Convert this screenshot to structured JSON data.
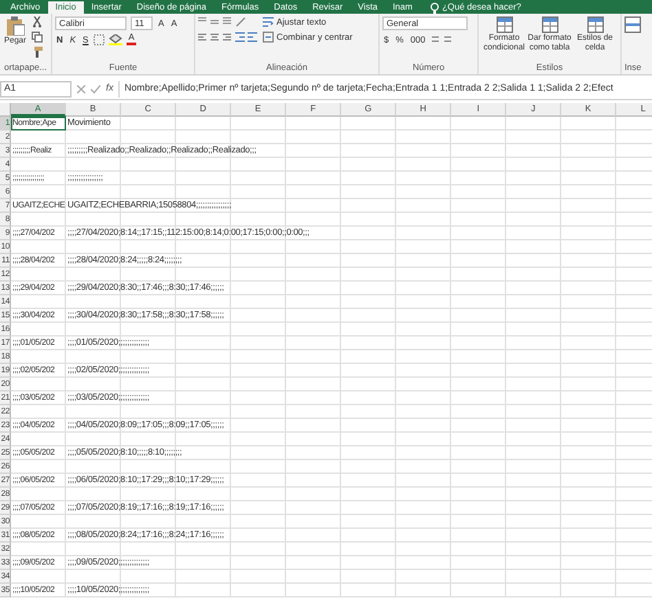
{
  "tabs": [
    {
      "label": "Archivo",
      "selected": false
    },
    {
      "label": "Inicio",
      "selected": true
    },
    {
      "label": "Insertar",
      "selected": false
    },
    {
      "label": "Diseño de página",
      "selected": false
    },
    {
      "label": "Fórmulas",
      "selected": false
    },
    {
      "label": "Datos",
      "selected": false
    },
    {
      "label": "Revisar",
      "selected": false
    },
    {
      "label": "Vista",
      "selected": false
    },
    {
      "label": "Inam",
      "selected": false
    }
  ],
  "tell_me": "¿Qué desea hacer?",
  "ribbon": {
    "clipboard": {
      "paste": "Pegar",
      "label": "ortapape..."
    },
    "font": {
      "name": "Calibri",
      "size": "11",
      "grow": "A",
      "shrink": "A",
      "bold": "N",
      "italic": "K",
      "underline": "S",
      "font_color_button": "A",
      "label": "Fuente"
    },
    "alignment": {
      "wrap": "Ajustar texto",
      "merge": "Combinar y centrar",
      "label": "Alineación"
    },
    "number": {
      "format": "General",
      "currency": "$",
      "percent": "%",
      "thousands": "000",
      "label": "Número"
    },
    "styles": {
      "conditional": "Formato condicional",
      "table": "Dar formato como tabla",
      "cell": "Estilos de celda",
      "label": "Estilos"
    },
    "insert": {
      "label": "Inse"
    }
  },
  "formula_bar": {
    "name_box": "A1",
    "function_label": "fx",
    "formula": "Nombre;Apellido;Primer nº tarjeta;Segundo nº de tarjeta;Fecha;Entrada 1 1;Entrada 2 2;Salida 1 1;Salida 2 2;Efect"
  },
  "columns": [
    {
      "label": "A",
      "selected": true
    },
    {
      "label": "B",
      "selected": false
    },
    {
      "label": "C",
      "selected": false
    },
    {
      "label": "D",
      "selected": false
    },
    {
      "label": "E",
      "selected": false
    },
    {
      "label": "F",
      "selected": false
    },
    {
      "label": "G",
      "selected": false
    },
    {
      "label": "H",
      "selected": false
    },
    {
      "label": "I",
      "selected": false
    },
    {
      "label": "J",
      "selected": false
    },
    {
      "label": "K",
      "selected": false
    },
    {
      "label": "L",
      "selected": false
    }
  ],
  "rows": [
    {
      "number": "1",
      "selected": true,
      "cells": [
        {
          "text": "Nombre;Ape",
          "selected": true
        },
        {
          "text": "Movimiento",
          "selected": false
        }
      ]
    },
    {
      "number": "2",
      "selected": false
    },
    {
      "number": "3",
      "selected": false,
      "cells": [
        {
          "text": ";;;;;;;;;Realiz",
          "selected": false
        },
        {
          "text": ";;;;;;;;;Realizado;;Realizado;;Realizado;;Realizado;;;",
          "selected": false
        }
      ]
    },
    {
      "number": "4",
      "selected": false
    },
    {
      "number": "5",
      "selected": false,
      "cells": [
        {
          "text": ";;;;;;;;;;;;;;;;",
          "selected": false
        },
        {
          "text": ";;;;;;;;;;;;;;;;",
          "selected": false
        }
      ]
    },
    {
      "number": "6",
      "selected": false
    },
    {
      "number": "7",
      "selected": false,
      "cells": [
        {
          "text": "UGAITZ;ECHE",
          "selected": false
        },
        {
          "text": "UGAITZ;ECHEBARRIA;15058804;;;;;;;;;;;;;;;;",
          "selected": false
        }
      ]
    },
    {
      "number": "8",
      "selected": false
    },
    {
      "number": "9",
      "selected": false,
      "cells": [
        {
          "text": ";;;;27/04/202",
          "selected": false
        },
        {
          "text": ";;;;27/04/2020;8:14;;17:15;;112:15:00;8:14;0:00;17:15;0:00;;0:00;;;",
          "selected": false
        }
      ]
    },
    {
      "number": "10",
      "selected": false
    },
    {
      "number": "11",
      "selected": false,
      "cells": [
        {
          "text": ";;;;28/04/202",
          "selected": false
        },
        {
          "text": ";;;;28/04/2020;8:24;;;;;8:24;;;;;;;;",
          "selected": false
        }
      ]
    },
    {
      "number": "12",
      "selected": false
    },
    {
      "number": "13",
      "selected": false,
      "cells": [
        {
          "text": ";;;;29/04/202",
          "selected": false
        },
        {
          "text": ";;;;29/04/2020;8:30;;17:46;;;8:30;;17:46;;;;;;",
          "selected": false
        }
      ]
    },
    {
      "number": "14",
      "selected": false
    },
    {
      "number": "15",
      "selected": false,
      "cells": [
        {
          "text": ";;;;30/04/202",
          "selected": false
        },
        {
          "text": ";;;;30/04/2020;8:30;;17:58;;;8:30;;17:58;;;;;;",
          "selected": false
        }
      ]
    },
    {
      "number": "16",
      "selected": false
    },
    {
      "number": "17",
      "selected": false,
      "cells": [
        {
          "text": ";;;;01/05/202",
          "selected": false
        },
        {
          "text": ";;;;01/05/2020;;;;;;;;;;;;;;",
          "selected": false
        }
      ]
    },
    {
      "number": "18",
      "selected": false
    },
    {
      "number": "19",
      "selected": false,
      "cells": [
        {
          "text": ";;;;02/05/202",
          "selected": false
        },
        {
          "text": ";;;;02/05/2020;;;;;;;;;;;;;;",
          "selected": false
        }
      ]
    },
    {
      "number": "20",
      "selected": false
    },
    {
      "number": "21",
      "selected": false,
      "cells": [
        {
          "text": ";;;;03/05/202",
          "selected": false
        },
        {
          "text": ";;;;03/05/2020;;;;;;;;;;;;;;",
          "selected": false
        }
      ]
    },
    {
      "number": "22",
      "selected": false
    },
    {
      "number": "23",
      "selected": false,
      "cells": [
        {
          "text": ";;;;04/05/202",
          "selected": false
        },
        {
          "text": ";;;;04/05/2020;8:09;;17:05;;;8:09;;17:05;;;;;;",
          "selected": false
        }
      ]
    },
    {
      "number": "24",
      "selected": false
    },
    {
      "number": "25",
      "selected": false,
      "cells": [
        {
          "text": ";;;;05/05/202",
          "selected": false
        },
        {
          "text": ";;;;05/05/2020;8:10;;;;;8:10;;;;;;;;",
          "selected": false
        }
      ]
    },
    {
      "number": "26",
      "selected": false
    },
    {
      "number": "27",
      "selected": false,
      "cells": [
        {
          "text": ";;;;06/05/202",
          "selected": false
        },
        {
          "text": ";;;;06/05/2020;8:10;;17:29;;;8:10;;17:29;;;;;;",
          "selected": false
        }
      ]
    },
    {
      "number": "28",
      "selected": false
    },
    {
      "number": "29",
      "selected": false,
      "cells": [
        {
          "text": ";;;;07/05/202",
          "selected": false
        },
        {
          "text": ";;;;07/05/2020;8:19;;17:16;;;8:19;;17:16;;;;;;",
          "selected": false
        }
      ]
    },
    {
      "number": "30",
      "selected": false
    },
    {
      "number": "31",
      "selected": false,
      "cells": [
        {
          "text": ";;;;08/05/202",
          "selected": false
        },
        {
          "text": ";;;;08/05/2020;8:24;;17:16;;;8:24;;17:16;;;;;;",
          "selected": false
        }
      ]
    },
    {
      "number": "32",
      "selected": false
    },
    {
      "number": "33",
      "selected": false,
      "cells": [
        {
          "text": ";;;;09/05/202",
          "selected": false
        },
        {
          "text": ";;;;09/05/2020;;;;;;;;;;;;;;",
          "selected": false
        }
      ]
    },
    {
      "number": "34",
      "selected": false
    },
    {
      "number": "35",
      "selected": false,
      "cells": [
        {
          "text": ";;;;10/05/202",
          "selected": false
        },
        {
          "text": ";;;;10/05/2020;;;;;;;;;;;;;;",
          "selected": false
        }
      ]
    }
  ]
}
